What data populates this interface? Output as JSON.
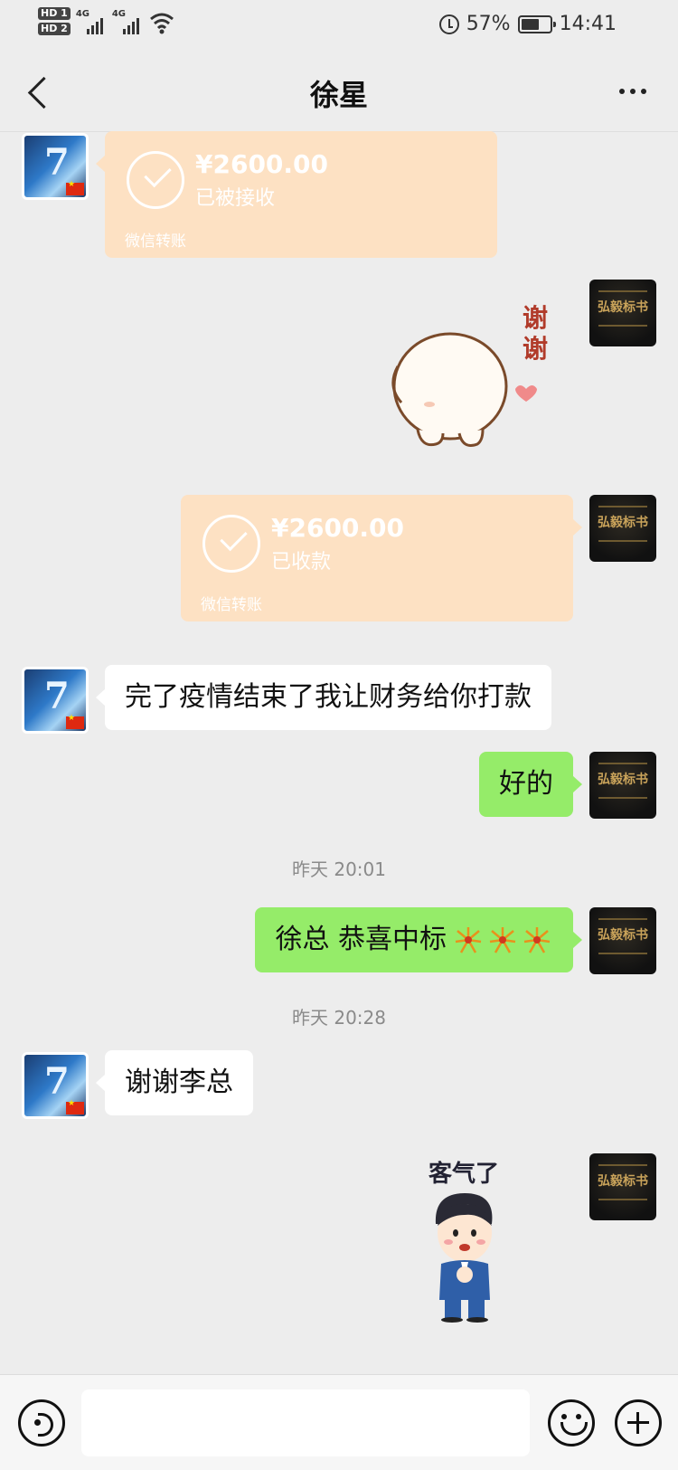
{
  "status_bar": {
    "hd_badge_1": "HD 1",
    "hd_badge_2": "HD 2",
    "signal_1_label": "4G",
    "signal_2_label": "4G",
    "battery": "57%",
    "time": "14:41",
    "icons": [
      "signal-icon",
      "wifi-icon",
      "alarm-icon",
      "battery-icon"
    ]
  },
  "nav": {
    "title": "徐星",
    "icons": [
      "back-icon",
      "more-icon"
    ]
  },
  "messages": {
    "transfer_1": {
      "amount": "¥2600.00",
      "status": "已被接收",
      "brand": "微信转账"
    },
    "sticker_thanks": {
      "text": "谢谢"
    },
    "transfer_2": {
      "amount": "¥2600.00",
      "status": "已收款",
      "brand": "微信转账"
    },
    "msg_friend_1": "完了疫情结束了我让财务给你打款",
    "msg_me_1": "好的",
    "time_1": "昨天 20:01",
    "msg_me_2": "徐总 恭喜中标",
    "time_2": "昨天 20:28",
    "msg_friend_2": "谢谢李总",
    "sticker_welcome": {
      "text": "客气了"
    }
  },
  "avatars": {
    "me_logo": "弘毅标书"
  },
  "input_bar": {
    "placeholder": "",
    "icons": [
      "voice-icon",
      "emoji-icon",
      "plus-icon"
    ]
  },
  "colors": {
    "background": "#ededed",
    "green_bubble": "#95ec69",
    "transfer_bubble": "#fde1c3"
  }
}
